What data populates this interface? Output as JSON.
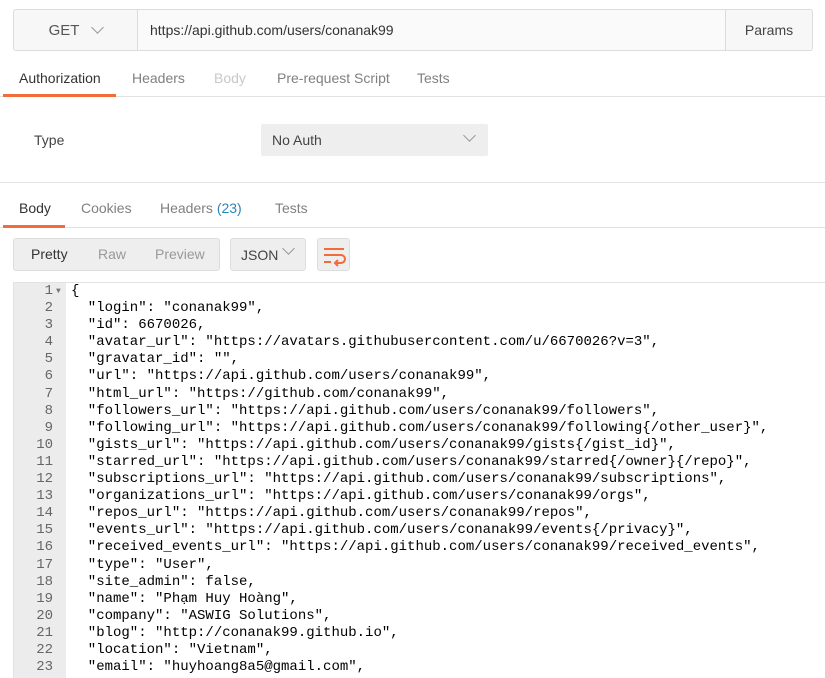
{
  "request": {
    "method": "GET",
    "url": "https://api.github.com/users/conanak99",
    "params_label": "Params"
  },
  "request_tabs": [
    {
      "label": "Authorization",
      "state": "active"
    },
    {
      "label": "Headers",
      "state": "normal"
    },
    {
      "label": "Body",
      "state": "disabled"
    },
    {
      "label": "Pre-request Script",
      "state": "normal"
    },
    {
      "label": "Tests",
      "state": "normal"
    }
  ],
  "auth": {
    "type_label": "Type",
    "type_value": "No Auth"
  },
  "response_tabs": {
    "body": "Body",
    "cookies": "Cookies",
    "headers": "Headers",
    "headers_count": "(23)",
    "tests": "Tests"
  },
  "view_modes": {
    "pretty": "Pretty",
    "raw": "Raw",
    "preview": "Preview",
    "active": "Pretty"
  },
  "format": "JSON",
  "icons": {
    "method_dropdown": "chevron-down-icon",
    "wrap": "wrap-lines-icon"
  },
  "colors": {
    "accent": "#f26b3a",
    "header_count": "#2a86b8"
  },
  "response_lines": [
    {
      "n": "1",
      "t": "{",
      "fold": true
    },
    {
      "n": "2",
      "t": "  \"login\": \"conanak99\","
    },
    {
      "n": "3",
      "t": "  \"id\": 6670026,"
    },
    {
      "n": "4",
      "t": "  \"avatar_url\": \"https://avatars.githubusercontent.com/u/6670026?v=3\","
    },
    {
      "n": "5",
      "t": "  \"gravatar_id\": \"\","
    },
    {
      "n": "6",
      "t": "  \"url\": \"https://api.github.com/users/conanak99\","
    },
    {
      "n": "7",
      "t": "  \"html_url\": \"https://github.com/conanak99\","
    },
    {
      "n": "8",
      "t": "  \"followers_url\": \"https://api.github.com/users/conanak99/followers\","
    },
    {
      "n": "9",
      "t": "  \"following_url\": \"https://api.github.com/users/conanak99/following{/other_user}\","
    },
    {
      "n": "10",
      "t": "  \"gists_url\": \"https://api.github.com/users/conanak99/gists{/gist_id}\","
    },
    {
      "n": "11",
      "t": "  \"starred_url\": \"https://api.github.com/users/conanak99/starred{/owner}{/repo}\","
    },
    {
      "n": "12",
      "t": "  \"subscriptions_url\": \"https://api.github.com/users/conanak99/subscriptions\","
    },
    {
      "n": "13",
      "t": "  \"organizations_url\": \"https://api.github.com/users/conanak99/orgs\","
    },
    {
      "n": "14",
      "t": "  \"repos_url\": \"https://api.github.com/users/conanak99/repos\","
    },
    {
      "n": "15",
      "t": "  \"events_url\": \"https://api.github.com/users/conanak99/events{/privacy}\","
    },
    {
      "n": "16",
      "t": "  \"received_events_url\": \"https://api.github.com/users/conanak99/received_events\","
    },
    {
      "n": "17",
      "t": "  \"type\": \"User\","
    },
    {
      "n": "18",
      "t": "  \"site_admin\": false,"
    },
    {
      "n": "19",
      "t": "  \"name\": \"Phạm Huy Hoàng\","
    },
    {
      "n": "20",
      "t": "  \"company\": \"ASWIG Solutions\","
    },
    {
      "n": "21",
      "t": "  \"blog\": \"http://conanak99.github.io\","
    },
    {
      "n": "22",
      "t": "  \"location\": \"Vietnam\","
    },
    {
      "n": "23",
      "t": "  \"email\": \"huyhoang8a5@gmail.com\","
    }
  ]
}
